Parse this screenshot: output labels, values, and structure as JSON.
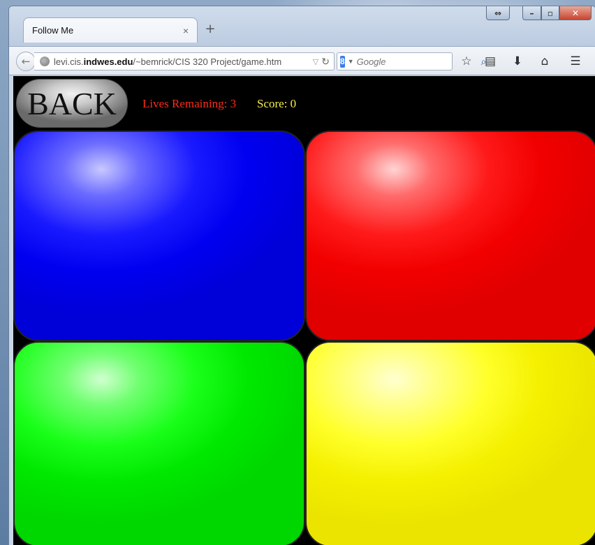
{
  "browser": {
    "tab": {
      "title": "Follow Me",
      "close_glyph": "×"
    },
    "new_tab_glyph": "+",
    "url": {
      "prefix": "levi.cis.",
      "domain": "indwes.edu",
      "path": "/~bemrick/CIS 320 Project/game.htm"
    },
    "search": {
      "placeholder": "Google",
      "engine_letter": "8"
    },
    "icons": [
      "back-arrow-icon",
      "globe-icon",
      "dropdown-icon",
      "reload-icon",
      "search-icon",
      "bookmark-star-icon",
      "reading-list-icon",
      "download-icon",
      "home-icon",
      "menu-icon"
    ]
  },
  "game": {
    "back_label": "BACK",
    "lives_label": "Lives Remaining: 3",
    "score_label": "Score: 0",
    "pads": [
      {
        "name": "blue",
        "color": "#0000f0"
      },
      {
        "name": "red",
        "color": "#f20000"
      },
      {
        "name": "green",
        "color": "#00e800"
      },
      {
        "name": "yellow",
        "color": "#f4f000"
      }
    ],
    "colors": {
      "lives_text": "#ff2b1a",
      "score_text": "#f7f04a",
      "background": "#000000"
    }
  }
}
